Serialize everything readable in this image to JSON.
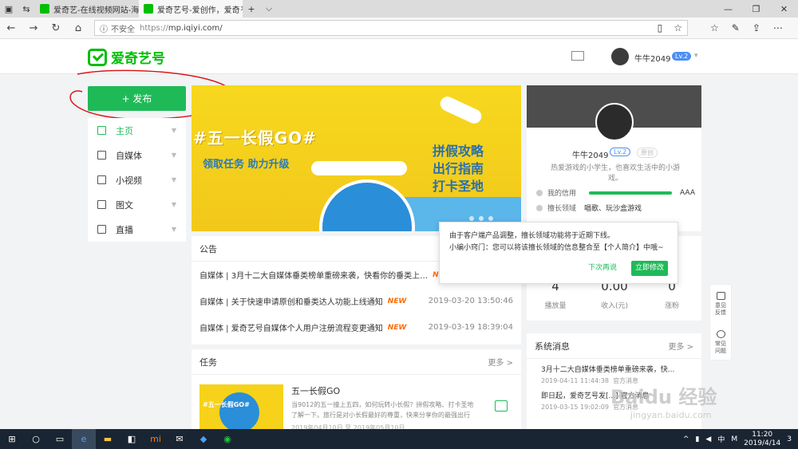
{
  "browser": {
    "tabs": [
      {
        "title": "爱奇艺-在线视频网站-海量正"
      },
      {
        "title": "爱奇艺号-爱创作，爱奇"
      }
    ],
    "new_tab": "+",
    "tab_menu": "⌵",
    "url_prefix": "不安全",
    "url_scheme": "https://",
    "url": "mp.iqiyi.com/"
  },
  "header": {
    "logo": "爱奇艺号",
    "user": "牛牛2049",
    "level": "Lv.2"
  },
  "publish": "+ 发布",
  "nav": [
    {
      "label": "主页",
      "icon": "home-icon"
    },
    {
      "label": "自媒体",
      "icon": "media-icon"
    },
    {
      "label": "小视频",
      "icon": "video-icon"
    },
    {
      "label": "图文",
      "icon": "article-icon"
    },
    {
      "label": "直播",
      "icon": "live-icon"
    }
  ],
  "banner": {
    "headline": "#五一长假GO#",
    "sub": "领取任务 助力升级",
    "right1": "拼假攻略",
    "right2": "出行指南",
    "right3": "打卡圣地"
  },
  "announcement": {
    "title": "公告",
    "rows": [
      {
        "text": "自媒体 | 3月十二大自媒体垂类榜单重磅来袭，快看你的垂类上…",
        "new": "NEW",
        "date": ""
      },
      {
        "text": "自媒体 | 关于快速申请原创和垂类达人功能上线通知",
        "new": "NEW",
        "date": "2019-03-20 13:50:46"
      },
      {
        "text": "自媒体 | 爱奇艺号自媒体个人用户注册流程变更通知",
        "new": "NEW",
        "date": "2019-03-19 18:39:04"
      }
    ]
  },
  "task": {
    "title": "任务",
    "more": "更多 >",
    "name": "五一长假GO",
    "desc": "当9012的五一撞上五四，如何玩转小长假？拼假攻略、打卡圣地了解一下。旅行是对小长假最好的尊重，快来分享你的最强出行",
    "date": "2019年04月10日 至 2019年05月10日",
    "img_text": "#五一长假GO#"
  },
  "profile": {
    "name": "牛牛2049",
    "level": "Lv.2",
    "tag": "原创",
    "bio": "热爱游戏的小学生，也喜欢生活中的小游戏。",
    "credit_label": "我的信用",
    "credit_value": "AAA",
    "field_label": "擅长领域",
    "field_value": "唱歌、玩沙盒游戏"
  },
  "popup": {
    "line1": "由于客户端产品调整，擅长领域功能将于近期下线。",
    "line2": "小编小窍门：您可以将该擅长领域的信息整合至【个人简介】中哦~",
    "later": "下次再说",
    "edit": "立即修改"
  },
  "stats": [
    {
      "value": "4",
      "label": "播放量"
    },
    {
      "value": "0.00",
      "label": "收入(元)"
    },
    {
      "value": "0",
      "label": "涨粉"
    }
  ],
  "messages": {
    "title": "系统消息",
    "more": "更多 >",
    "rows": [
      {
        "text": "3月十二大自媒体垂类榜单重磅来袭，快...",
        "date": "2019-04-11 11:44:38",
        "src": "官方消息"
      },
      {
        "text": "即日起，爱奇艺号发[...] 官方消息",
        "date": "2019-03-15 19:02:09",
        "src": "官方消息"
      }
    ]
  },
  "side": [
    {
      "label": "意见反馈"
    },
    {
      "label": "常见问题"
    }
  ],
  "watermark": "Baidu 经验",
  "watermark_url": "jingyan.baidu.com",
  "tray": {
    "ime": "中",
    "m": "M",
    "time": "11:20",
    "date": "2019/4/14",
    "notif": "3"
  }
}
